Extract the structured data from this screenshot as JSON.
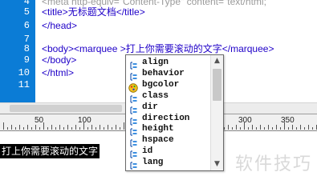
{
  "editor": {
    "lines": [
      {
        "num": "4",
        "text": "<meta http-equiv=\"Content-Type\" content=\"text/html;",
        "cut": true
      },
      {
        "num": "5",
        "text": "<title>无标题文档</title>"
      },
      {
        "num": "6",
        "text": "</head>"
      },
      {
        "num": "7",
        "text": ""
      },
      {
        "num": "8",
        "text": "<body><marquee >打上你需要滚动的文字</marquee>"
      },
      {
        "num": "9",
        "text": "</body>"
      },
      {
        "num": "10",
        "text": "</html>"
      },
      {
        "num": "11",
        "text": ""
      }
    ]
  },
  "ruler": {
    "labels": [
      "50",
      "100",
      "300",
      "350"
    ]
  },
  "design": {
    "marquee_text": "打上你需要滚动的文字"
  },
  "autocomplete": {
    "items": [
      {
        "label": "align",
        "icon": "attribute-icon"
      },
      {
        "label": "behavior",
        "icon": "attribute-icon"
      },
      {
        "label": "bgcolor",
        "icon": "color-palette-icon"
      },
      {
        "label": "class",
        "icon": "attribute-icon"
      },
      {
        "label": "dir",
        "icon": "attribute-icon"
      },
      {
        "label": "direction",
        "icon": "attribute-icon"
      },
      {
        "label": "height",
        "icon": "attribute-icon"
      },
      {
        "label": "hspace",
        "icon": "attribute-icon"
      },
      {
        "label": "id",
        "icon": "attribute-icon"
      },
      {
        "label": "lang",
        "icon": "attribute-icon"
      }
    ]
  },
  "watermark": "软件技巧",
  "colors": {
    "gutter": "#0b7cd6",
    "tag": "#1f00c8",
    "marquee_bg": "#000000"
  }
}
